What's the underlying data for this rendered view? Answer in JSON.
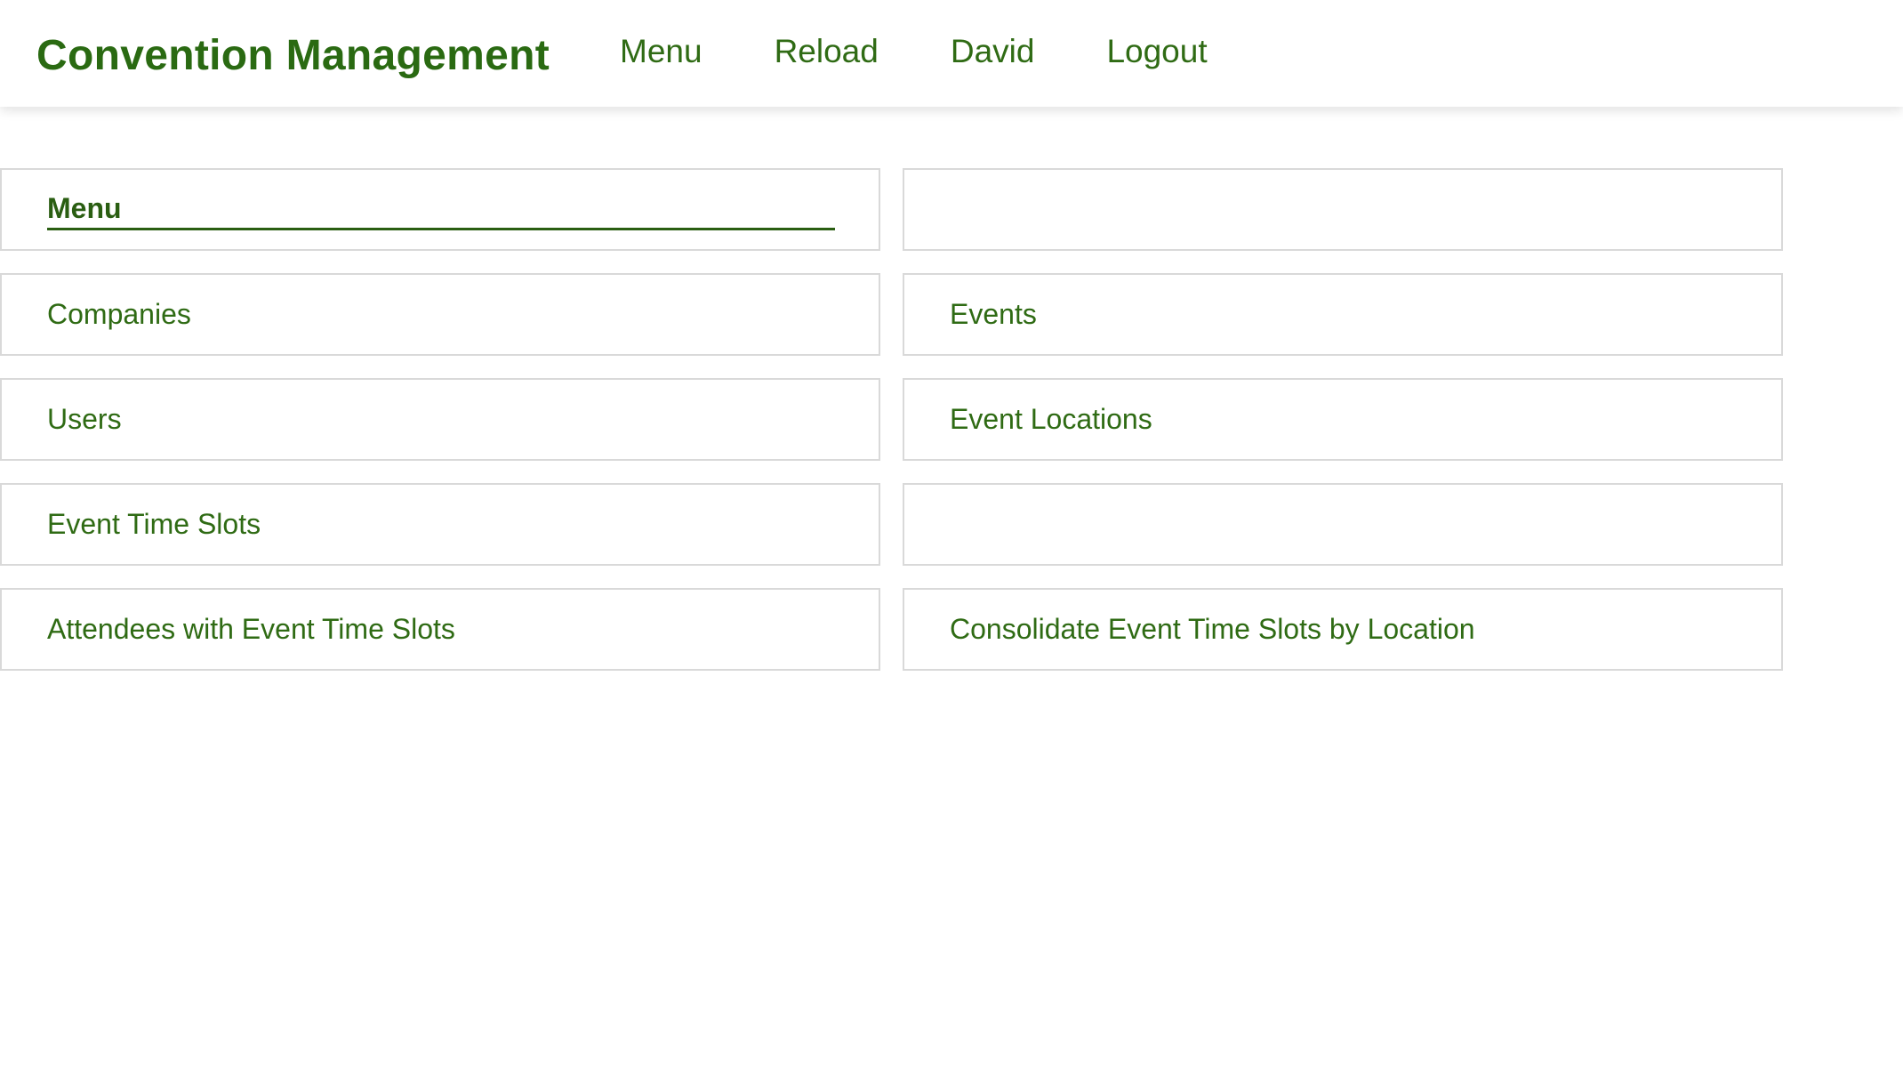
{
  "header": {
    "title": "Convention Management",
    "nav": {
      "menu": "Menu",
      "reload": "Reload",
      "user": "David",
      "logout": "Logout"
    }
  },
  "menu_panel": {
    "title": "Menu",
    "items": {
      "companies": "Companies",
      "events": "Events",
      "users": "Users",
      "event_locations": "Event Locations",
      "event_time_slots": "Event Time Slots",
      "attendees_with_event_time_slots": "Attendees with Event Time Slots",
      "consolidate_event_time_slots_by_location": "Consolidate Event Time Slots by Location"
    }
  },
  "colors": {
    "accent": "#2d6a0f",
    "border": "#d9d9d9",
    "background": "#ffffff"
  }
}
